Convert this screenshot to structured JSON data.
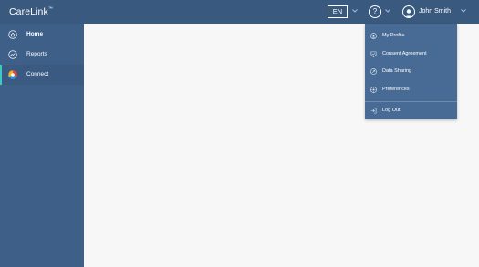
{
  "app": {
    "logo": "CareLink",
    "trademark": "™"
  },
  "header": {
    "language": "EN",
    "help_label": "?",
    "user_name": "John Smith"
  },
  "sidebar": {
    "items": [
      {
        "label": "Home",
        "icon": "home-icon"
      },
      {
        "label": "Reports",
        "icon": "reports-icon"
      },
      {
        "label": "Connect",
        "icon": "connect-icon"
      }
    ],
    "active_item": "Connect",
    "bold_item": "Home"
  },
  "user_menu": {
    "items": [
      {
        "label": "My Profile",
        "icon": "profile-icon"
      },
      {
        "label": "Consent Agreement",
        "icon": "consent-icon"
      },
      {
        "label": "Data Sharing",
        "icon": "data-sharing-icon"
      },
      {
        "label": "Preferences",
        "icon": "preferences-icon"
      },
      {
        "label": "Log Out",
        "icon": "logout-icon"
      }
    ]
  },
  "colors": {
    "header": "#39597e",
    "sidebar": "#3d5f88",
    "accent": "#3ec9c4",
    "dropdown": "#476b94",
    "content": "#f7f7f7"
  }
}
